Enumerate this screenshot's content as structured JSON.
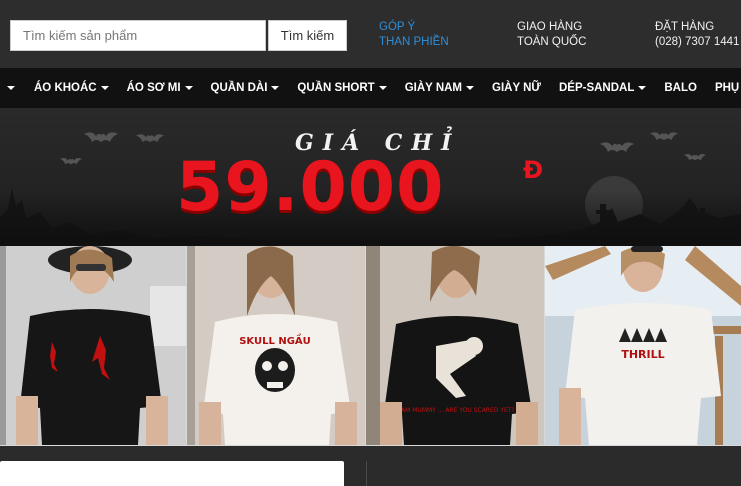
{
  "header": {
    "search_placeholder": "Tìm kiếm sản phẩm",
    "search_button": "Tìm kiếm",
    "feedback_line1": "GÓP Ý",
    "feedback_line2": "THAN PHIỀN",
    "shipping_line1": "GIAO HÀNG",
    "shipping_line2": "TOÀN QUỐC",
    "order_line1": "ĐẶT HÀNG",
    "order_line2": "(028) 7307 1441",
    "link_color": "#2f8fd8"
  },
  "nav": {
    "items": [
      {
        "label": "ÁO KHOÁC",
        "dropdown": true
      },
      {
        "label": "ÁO SƠ MI",
        "dropdown": true
      },
      {
        "label": "QUẦN DÀI",
        "dropdown": true
      },
      {
        "label": "QUẦN SHORT",
        "dropdown": true
      },
      {
        "label": "GIÀY NAM",
        "dropdown": true
      },
      {
        "label": "GIÀY NỮ",
        "dropdown": false
      },
      {
        "label": "DÉP-SANDAL",
        "dropdown": true
      },
      {
        "label": "BALO",
        "dropdown": false
      },
      {
        "label": "PHỤ KIỆN",
        "dropdown": true
      }
    ]
  },
  "banner": {
    "title": "GIÁ CHỈ",
    "price": "59.000",
    "currency": "Đ",
    "accent_color": "#e8141e"
  },
  "photos": {
    "shirt_prints": [
      "SKULL NGẦU",
      "I AM MUMMY ... ARE YOU SCARED YET?",
      "THRILL"
    ]
  }
}
